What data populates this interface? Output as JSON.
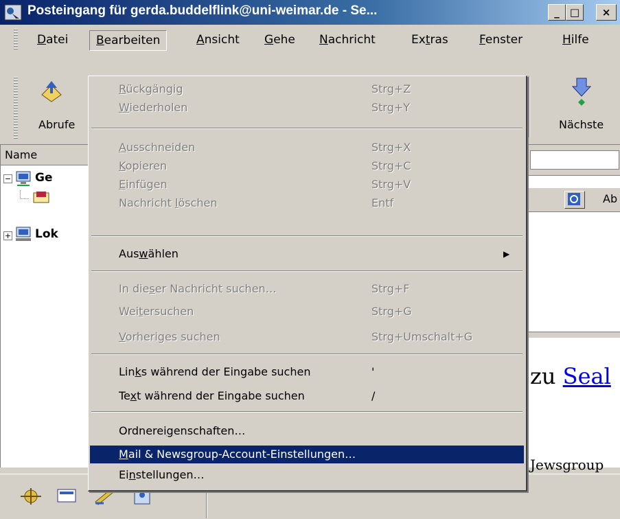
{
  "window": {
    "title": "Posteingang für gerda.buddelflink@uni-weimar.de - Se...",
    "minimize": "_",
    "maximize": "□",
    "close": "×"
  },
  "menubar": [
    {
      "pre": "",
      "key": "D",
      "post": "atei"
    },
    {
      "pre": "",
      "key": "B",
      "post": "earbeiten"
    },
    {
      "pre": "",
      "key": "A",
      "post": "nsicht"
    },
    {
      "pre": "",
      "key": "G",
      "post": "ehe"
    },
    {
      "pre": "",
      "key": "N",
      "post": "achricht"
    },
    {
      "pre": "Ex",
      "key": "t",
      "post": "ras"
    },
    {
      "pre": "",
      "key": "F",
      "post": "enster"
    },
    {
      "pre": "",
      "key": "H",
      "post": "ilfe"
    }
  ],
  "toolbar": {
    "get_label": "Abrufe",
    "next_label": "Nächste"
  },
  "left_panel": {
    "column_header": "Name",
    "account1": "Ge",
    "account2": "Lok",
    "expand1": "−",
    "expand2": "+"
  },
  "right_panel": {
    "column_label": "Ab",
    "preview_text1": "zu ",
    "preview_link": "Seal",
    "preview_text2": "Jewsgroup"
  },
  "edit_menu": {
    "undo": {
      "pre": "",
      "key": "R",
      "post": "ückgängig",
      "shortcut": "Strg+Z"
    },
    "redo": {
      "pre": "",
      "key": "W",
      "post": "iederholen",
      "shortcut": "Strg+Y"
    },
    "cut": {
      "pre": "",
      "key": "A",
      "post": "usschneiden",
      "shortcut": "Strg+X"
    },
    "copy": {
      "pre": "",
      "key": "K",
      "post": "opieren",
      "shortcut": "Strg+C"
    },
    "paste": {
      "pre": "",
      "key": "E",
      "post": "infügen",
      "shortcut": "Strg+V"
    },
    "delete": {
      "pre": "Nachricht ",
      "key": "l",
      "post": "öschen",
      "shortcut": "Entf"
    },
    "select": {
      "pre": "Aus",
      "key": "w",
      "post": "ählen",
      "arrow": "▶"
    },
    "find_in_message": {
      "pre": "In die",
      "key": "s",
      "post": "er Nachricht suchen…",
      "shortcut": "Strg+F"
    },
    "find_again": {
      "pre": "Wei",
      "key": "t",
      "post": "ersuchen",
      "shortcut": "Strg+G"
    },
    "find_previous": {
      "pre": "",
      "key": "V",
      "post": "orheriges suchen",
      "shortcut": "Strg+Umschalt+G"
    },
    "find_links": {
      "pre": "Lin",
      "key": "k",
      "post": "s während der Eingabe suchen",
      "shortcut": "'"
    },
    "find_text": {
      "pre": "Te",
      "key": "x",
      "post": "t während der Eingabe suchen",
      "shortcut": "/"
    },
    "folder_props": {
      "pre": "Ordnerei",
      "key": "g",
      "post": "enschaften…"
    },
    "account_settings": {
      "pre": "",
      "key": "M",
      "post": "ail & Newsgroup-Account-Einstellungen…"
    },
    "preferences": {
      "pre": "Ei",
      "key": "n",
      "post": "stellungen…"
    }
  },
  "colors": {
    "title_start": "#0a246a",
    "title_end": "#a6caf0",
    "highlight": "#0a246a",
    "link": "#0000ee"
  }
}
